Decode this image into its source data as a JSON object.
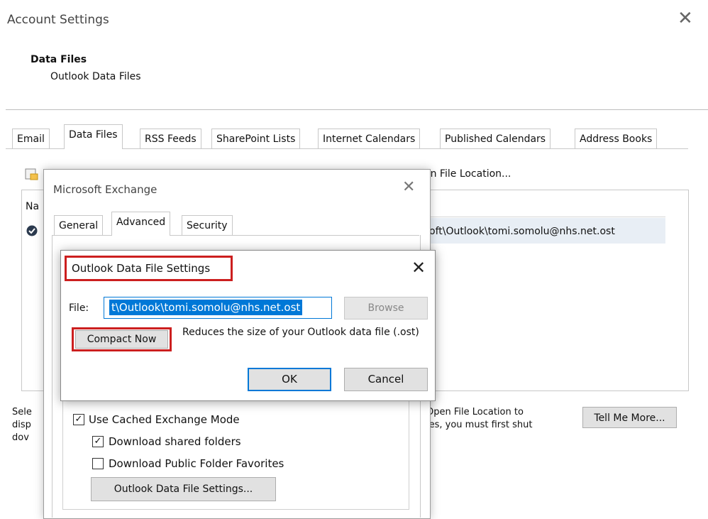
{
  "account_settings": {
    "title": "Account Settings",
    "section_title": "Data Files",
    "section_subtitle": "Outlook Data Files",
    "tabs": [
      {
        "label": "Email"
      },
      {
        "label": "Data Files",
        "active": true
      },
      {
        "label": "RSS Feeds"
      },
      {
        "label": "SharePoint Lists"
      },
      {
        "label": "Internet Calendars"
      },
      {
        "label": "Published Calendars"
      },
      {
        "label": "Address Books"
      }
    ],
    "toolbar_open_file_location": "en File Location...",
    "list_path": "oft\\Outlook\\tomi.somolu@nhs.net.ost",
    "bottom_text_line1": "Open File Location to",
    "bottom_text_line2": "les, you must first shut",
    "left_fragment_lines": [
      "Sele",
      "disp",
      "dov"
    ],
    "tell_me_more": "Tell Me More..."
  },
  "exchange_dialog": {
    "title": "Microsoft Exchange",
    "tabs": [
      {
        "label": "General"
      },
      {
        "label": "Advanced",
        "active": true
      },
      {
        "label": "Security"
      }
    ],
    "use_cached": {
      "label": "Use Cached Exchange Mode",
      "checked": true
    },
    "download_shared": {
      "label": "Download shared folders",
      "checked": true
    },
    "download_public": {
      "label": "Download Public Folder Favorites",
      "checked": false
    },
    "data_file_settings_button": "Outlook Data File Settings..."
  },
  "data_file_dialog": {
    "title": "Outlook Data File Settings",
    "file_label": "File:",
    "file_value": "t\\Outlook\\tomi.somolu@nhs.net.ost",
    "browse": "Browse",
    "compact_now": "Compact Now",
    "compact_desc": "Reduces the size of your Outlook data file (.ost)",
    "ok": "OK",
    "cancel": "Cancel"
  },
  "colors": {
    "highlight_red": "#cc1f1f",
    "selection_blue": "#0078d7"
  }
}
